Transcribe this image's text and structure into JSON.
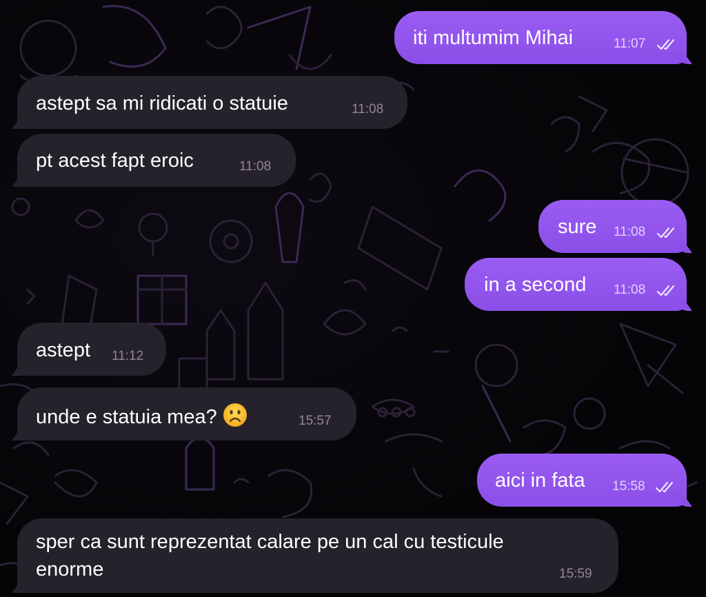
{
  "chat": {
    "messages": [
      {
        "id": "m1",
        "direction": "outgoing",
        "text": "iti multumim Mihai",
        "time": "11:07",
        "read": true
      },
      {
        "id": "m2",
        "direction": "incoming",
        "text": "astept sa mi ridicati o statuie",
        "time": "11:08"
      },
      {
        "id": "m3",
        "direction": "incoming",
        "text": "pt acest fapt eroic",
        "time": "11:08"
      },
      {
        "id": "m4",
        "direction": "outgoing",
        "text": "sure",
        "time": "11:08",
        "read": true
      },
      {
        "id": "m5",
        "direction": "outgoing",
        "text": "in a second",
        "time": "11:08",
        "read": true
      },
      {
        "id": "m6",
        "direction": "incoming",
        "text": "astept",
        "time": "11:12"
      },
      {
        "id": "m7",
        "direction": "incoming",
        "text": "unde e statuia mea?",
        "emoji": "frowning-face-emoji",
        "time": "15:57"
      },
      {
        "id": "m8",
        "direction": "outgoing",
        "text": "aici in fata",
        "time": "15:58",
        "read": true
      },
      {
        "id": "m9",
        "direction": "incoming",
        "text_line1": "sper ca sunt reprezentat calare pe un cal cu testicule",
        "text_line2": "enorme",
        "time": "15:59"
      }
    ]
  },
  "theme": {
    "outgoing_bubble": "#8a4fe8",
    "incoming_bubble": "#26222b",
    "background": "#060507",
    "doodle_stroke": "#2a2236"
  }
}
